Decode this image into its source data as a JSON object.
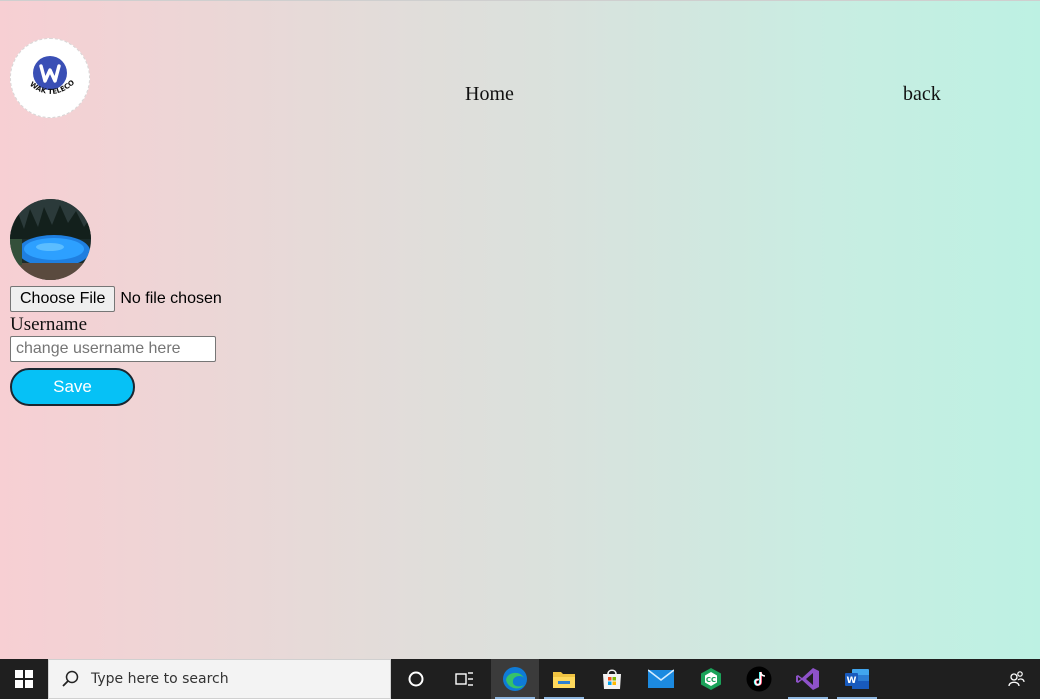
{
  "header": {
    "logo_text": "WAK TELECOM",
    "logo_letter": "W",
    "nav": {
      "home_label": "Home",
      "back_label": "back"
    }
  },
  "profile": {
    "avatar_alt": "pool-photo",
    "file_button_label": "Choose File",
    "file_status": "No file chosen",
    "username_label": "Username",
    "username_value": "",
    "username_placeholder": "change username here",
    "save_label": "Save"
  },
  "taskbar": {
    "search_placeholder": "Type here to search",
    "apps": [
      {
        "name": "cortana-icon"
      },
      {
        "name": "task-view-icon"
      },
      {
        "name": "edge-icon"
      },
      {
        "name": "file-explorer-icon"
      },
      {
        "name": "microsoft-store-icon"
      },
      {
        "name": "mail-icon"
      },
      {
        "name": "ccleaner-icon"
      },
      {
        "name": "tiktok-icon"
      },
      {
        "name": "visual-studio-icon"
      },
      {
        "name": "word-icon"
      }
    ]
  },
  "colors": {
    "gradient_left": "#f7cfd3",
    "gradient_right": "#bdf1e3",
    "save_button": "#06c1f6",
    "taskbar": "#1f1f1f"
  }
}
